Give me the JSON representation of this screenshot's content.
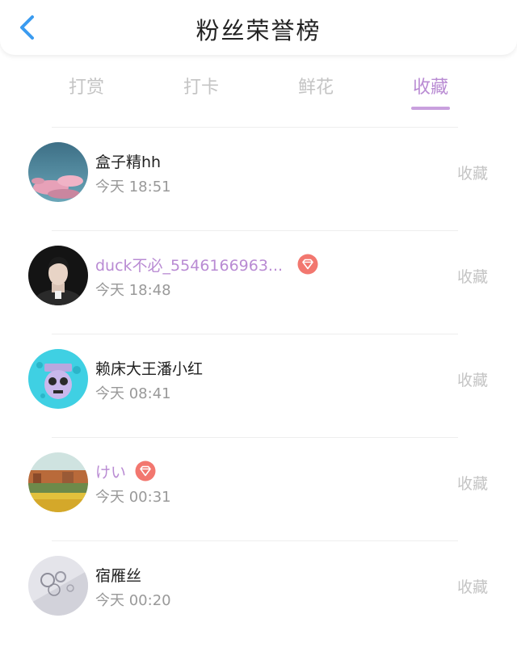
{
  "header": {
    "title": "粉丝荣誉榜",
    "back_icon": "chevron-left-icon"
  },
  "tabs": [
    {
      "label": "打赏",
      "active": false
    },
    {
      "label": "打卡",
      "active": false
    },
    {
      "label": "鲜花",
      "active": false
    },
    {
      "label": "收藏",
      "active": true
    }
  ],
  "colors": {
    "accent": "#b98bd3",
    "back_icon": "#3a9bf0",
    "gem_badge": "#f2776f"
  },
  "fans": [
    {
      "name": "盒子精hh",
      "time": "今天 18:51",
      "action": "收藏",
      "vip": false,
      "avatar": "sky-clouds"
    },
    {
      "name": "duck不必_5546166963...",
      "time": "今天 18:48",
      "action": "收藏",
      "vip": true,
      "avatar": "portrait-dark"
    },
    {
      "name": "赖床大王潘小红",
      "time": "今天 08:41",
      "action": "收藏",
      "vip": false,
      "avatar": "cartoon-cyan"
    },
    {
      "name": "けい",
      "time": "今天 00:31",
      "action": "收藏",
      "vip": true,
      "avatar": "landscape-field"
    },
    {
      "name": "宿雁丝",
      "time": "今天 00:20",
      "action": "收藏",
      "vip": false,
      "avatar": "white-lace"
    }
  ]
}
